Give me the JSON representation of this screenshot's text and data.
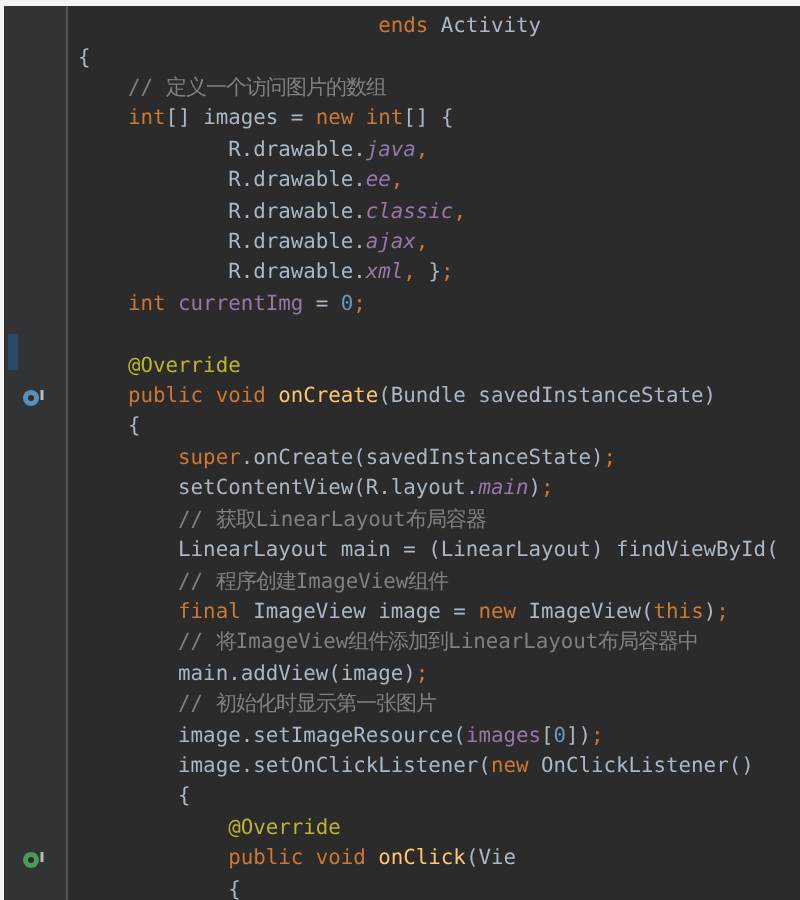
{
  "editor": {
    "lines": [
      {
        "kind": "code",
        "tokens": [
          {
            "text": "                        ends ",
            "kind": "keyword"
          },
          {
            "text": "Activity",
            "kind": "plain"
          }
        ]
      },
      {
        "kind": "code",
        "tokens": [
          {
            "text": "{",
            "kind": "plain"
          }
        ]
      },
      {
        "kind": "code",
        "tokens": [
          {
            "text": "    // 定义一个访问图片的数组",
            "kind": "comment"
          }
        ]
      },
      {
        "kind": "code",
        "tokens": [
          {
            "text": "    int",
            "kind": "keyword"
          },
          {
            "text": "[] images = ",
            "kind": "plain"
          },
          {
            "text": "new int",
            "kind": "keyword"
          },
          {
            "text": "[] {",
            "kind": "plain"
          }
        ]
      },
      {
        "kind": "code",
        "tokens": [
          {
            "text": "            R.drawable.",
            "kind": "plain"
          },
          {
            "text": "java",
            "kind": "field"
          },
          {
            "text": ",",
            "kind": "punct"
          }
        ]
      },
      {
        "kind": "code",
        "tokens": [
          {
            "text": "            R.drawable.",
            "kind": "plain"
          },
          {
            "text": "ee",
            "kind": "field"
          },
          {
            "text": ",",
            "kind": "punct"
          }
        ]
      },
      {
        "kind": "code",
        "tokens": [
          {
            "text": "            R.drawable.",
            "kind": "plain"
          },
          {
            "text": "classic",
            "kind": "field"
          },
          {
            "text": ",",
            "kind": "punct"
          }
        ]
      },
      {
        "kind": "code",
        "tokens": [
          {
            "text": "            R.drawable.",
            "kind": "plain"
          },
          {
            "text": "ajax",
            "kind": "field"
          },
          {
            "text": ",",
            "kind": "punct"
          }
        ]
      },
      {
        "kind": "code",
        "tokens": [
          {
            "text": "            R.drawable.",
            "kind": "plain"
          },
          {
            "text": "xml",
            "kind": "field"
          },
          {
            "text": ", ",
            "kind": "punct"
          },
          {
            "text": "}",
            "kind": "plain"
          },
          {
            "text": ";",
            "kind": "punct"
          }
        ]
      },
      {
        "kind": "code",
        "tokens": [
          {
            "text": "    int ",
            "kind": "keyword"
          },
          {
            "text": "currentImg",
            "kind": "member"
          },
          {
            "text": " = ",
            "kind": "plain"
          },
          {
            "text": "0",
            "kind": "number"
          },
          {
            "text": ";",
            "kind": "punct"
          }
        ]
      },
      {
        "kind": "blank"
      },
      {
        "kind": "code",
        "marker": {
          "kind": "change"
        },
        "tokens": [
          {
            "text": "    @Override",
            "kind": "annotation"
          }
        ]
      },
      {
        "kind": "code",
        "marker": {
          "kind": "override"
        },
        "tokens": [
          {
            "text": "    public void ",
            "kind": "keyword"
          },
          {
            "text": "onCreate",
            "kind": "method"
          },
          {
            "text": "(Bundle savedInstanceState)",
            "kind": "plain"
          }
        ]
      },
      {
        "kind": "code",
        "tokens": [
          {
            "text": "    {",
            "kind": "plain"
          }
        ]
      },
      {
        "kind": "code",
        "tokens": [
          {
            "text": "        super",
            "kind": "keyword"
          },
          {
            "text": ".onCreate(savedInstanceState)",
            "kind": "plain"
          },
          {
            "text": ";",
            "kind": "punct"
          }
        ]
      },
      {
        "kind": "code",
        "tokens": [
          {
            "text": "        setContentView(R.layout.",
            "kind": "plain"
          },
          {
            "text": "main",
            "kind": "field"
          },
          {
            "text": ")",
            "kind": "plain"
          },
          {
            "text": ";",
            "kind": "punct"
          }
        ]
      },
      {
        "kind": "code",
        "tokens": [
          {
            "text": "        // 获取LinearLayout布局容器",
            "kind": "comment"
          }
        ]
      },
      {
        "kind": "code",
        "tokens": [
          {
            "text": "        LinearLayout main = (LinearLayout) findViewById(",
            "kind": "plain"
          }
        ]
      },
      {
        "kind": "code",
        "tokens": [
          {
            "text": "        // 程序创建ImageView组件",
            "kind": "comment"
          }
        ]
      },
      {
        "kind": "code",
        "tokens": [
          {
            "text": "        final ",
            "kind": "keyword"
          },
          {
            "text": "ImageView image = ",
            "kind": "plain"
          },
          {
            "text": "new ",
            "kind": "keyword"
          },
          {
            "text": "ImageView(",
            "kind": "plain"
          },
          {
            "text": "this",
            "kind": "keyword"
          },
          {
            "text": ")",
            "kind": "plain"
          },
          {
            "text": ";",
            "kind": "punct"
          }
        ]
      },
      {
        "kind": "code",
        "tokens": [
          {
            "text": "        // 将ImageView组件添加到LinearLayout布局容器中",
            "kind": "comment"
          }
        ]
      },
      {
        "kind": "code",
        "tokens": [
          {
            "text": "        main.addView(image)",
            "kind": "plain"
          },
          {
            "text": ";",
            "kind": "punct"
          }
        ]
      },
      {
        "kind": "code",
        "tokens": [
          {
            "text": "        // 初始化时显示第一张图片",
            "kind": "comment"
          }
        ]
      },
      {
        "kind": "code",
        "tokens": [
          {
            "text": "        image.setImageResource(",
            "kind": "plain"
          },
          {
            "text": "images",
            "kind": "member"
          },
          {
            "text": "[",
            "kind": "plain"
          },
          {
            "text": "0",
            "kind": "number"
          },
          {
            "text": "])",
            "kind": "plain"
          },
          {
            "text": ";",
            "kind": "punct"
          }
        ]
      },
      {
        "kind": "code",
        "tokens": [
          {
            "text": "        image.setOnClickListener(",
            "kind": "plain"
          },
          {
            "text": "new ",
            "kind": "keyword"
          },
          {
            "text": "OnClickListener()",
            "kind": "plain"
          }
        ]
      },
      {
        "kind": "code",
        "tokens": [
          {
            "text": "        {",
            "kind": "plain"
          }
        ]
      },
      {
        "kind": "code",
        "tokens": [
          {
            "text": "            @Override",
            "kind": "annotation"
          }
        ]
      },
      {
        "kind": "code",
        "marker": {
          "kind": "implement"
        },
        "tokens": [
          {
            "text": "            public void ",
            "kind": "keyword"
          },
          {
            "text": "onClick",
            "kind": "method"
          },
          {
            "text": "(Vie",
            "kind": "plain"
          }
        ]
      },
      {
        "kind": "code",
        "tokens": [
          {
            "text": "            {",
            "kind": "plain"
          }
        ]
      }
    ]
  }
}
